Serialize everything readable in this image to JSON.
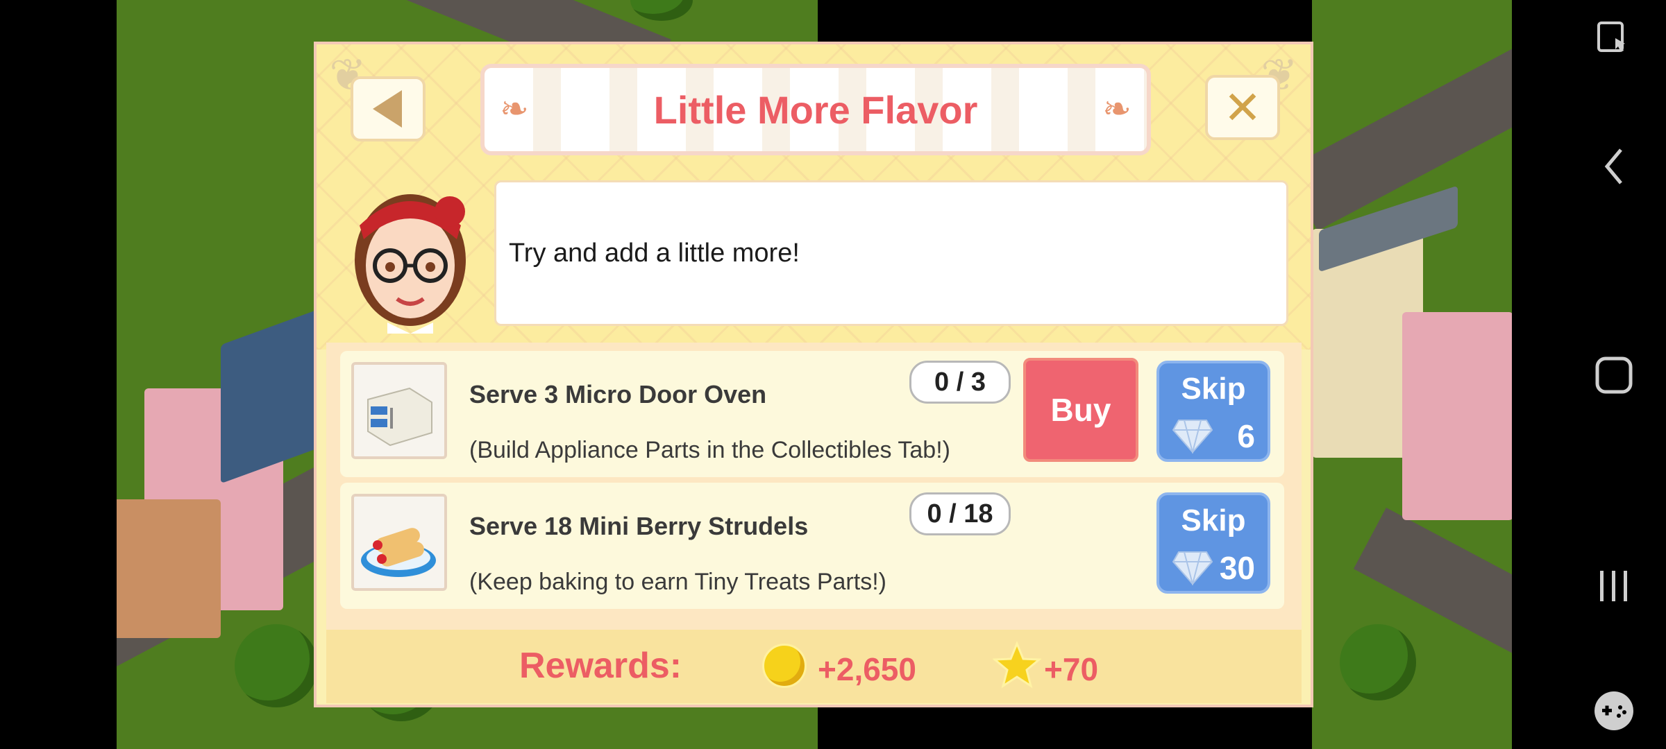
{
  "dialog": {
    "title": "Little More Flavor",
    "message": "Try and add a little more!",
    "tasks": [
      {
        "title": "Serve 3 Micro Door Oven",
        "subtitle": "(Build Appliance Parts in the Collectibles Tab!)",
        "progress": "0 / 3",
        "buy_label": "Buy",
        "skip_label": "Skip",
        "skip_cost": "6",
        "icon": "oven-icon"
      },
      {
        "title": "Serve 18 Mini Berry Strudels",
        "subtitle": "(Keep baking to earn Tiny Treats Parts!)",
        "progress": "0 / 18",
        "skip_label": "Skip",
        "skip_cost": "30",
        "icon": "strudel-icon"
      }
    ],
    "rewards": {
      "label": "Rewards:",
      "coins": "+2,650",
      "xp": "+70"
    }
  },
  "colors": {
    "accent": "#ec5d64",
    "buy": "#ef6470",
    "skip": "#5f95e2",
    "panel": "#fcec9f"
  }
}
